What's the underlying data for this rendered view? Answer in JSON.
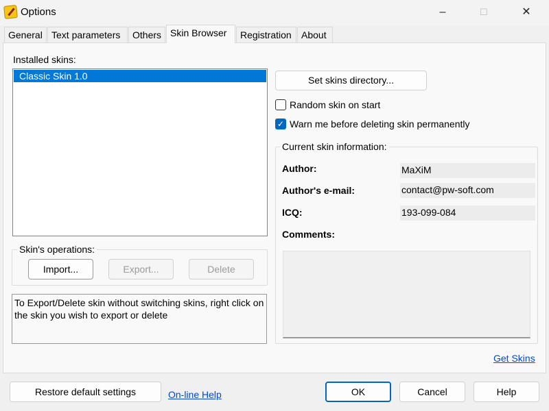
{
  "window": {
    "title": "Options",
    "minimize": "–",
    "maximize": "☐",
    "close": "✕"
  },
  "tabs": [
    {
      "label": "General"
    },
    {
      "label": "Text parameters"
    },
    {
      "label": "Others"
    },
    {
      "label": "Skin Browser"
    },
    {
      "label": "Registration"
    },
    {
      "label": "About"
    }
  ],
  "active_tab": "Skin Browser",
  "skin_browser": {
    "installed_label": "Installed skins:",
    "skins": [
      {
        "label": "Classic Skin 1.0",
        "selected": true
      }
    ],
    "set_dir_button": "Set skins directory...",
    "random_skin": {
      "label": "Random skin on start",
      "checked": false
    },
    "warn_delete": {
      "label": "Warn me before deleting skin permanently",
      "checked": true
    },
    "operations": {
      "legend": "Skin's operations:",
      "import": "Import...",
      "export": "Export...",
      "delete": "Delete"
    },
    "hint": "To Export/Delete skin without switching skins, right click on the skin you wish to export or delete",
    "info": {
      "legend": "Current skin information:",
      "author_label": "Author:",
      "author": "MaXiM",
      "email_label": "Author's e-mail:",
      "email": "contact@pw-soft.com",
      "icq_label": "ICQ:",
      "icq": "193-099-084",
      "comments_label": "Comments:",
      "comments": ""
    },
    "get_skins": "Get Skins"
  },
  "footer": {
    "restore": "Restore default settings",
    "online_help": "On-line Help",
    "ok": "OK",
    "cancel": "Cancel",
    "help": "Help"
  },
  "colors": {
    "selection": "#0078d7",
    "link": "#0645d1",
    "checkbox": "#0067c0"
  }
}
